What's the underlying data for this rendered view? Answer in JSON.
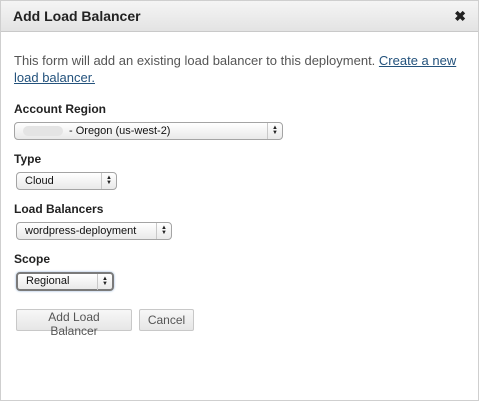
{
  "dialog": {
    "title": "Add Load Balancer",
    "close_glyph": "✖"
  },
  "intro": {
    "text": "This form will add an existing load balancer to this deployment. ",
    "link_text": "Create a new load balancer."
  },
  "fields": {
    "region": {
      "label": "Account Region",
      "value": "- Oregon (us-west-2)"
    },
    "type": {
      "label": "Type",
      "value": "Cloud"
    },
    "load_balancers": {
      "label": "Load Balancers",
      "value": "wordpress-deployment"
    },
    "scope": {
      "label": "Scope",
      "value": "Regional"
    }
  },
  "buttons": {
    "add": "Add Load Balancer",
    "cancel": "Cancel"
  }
}
